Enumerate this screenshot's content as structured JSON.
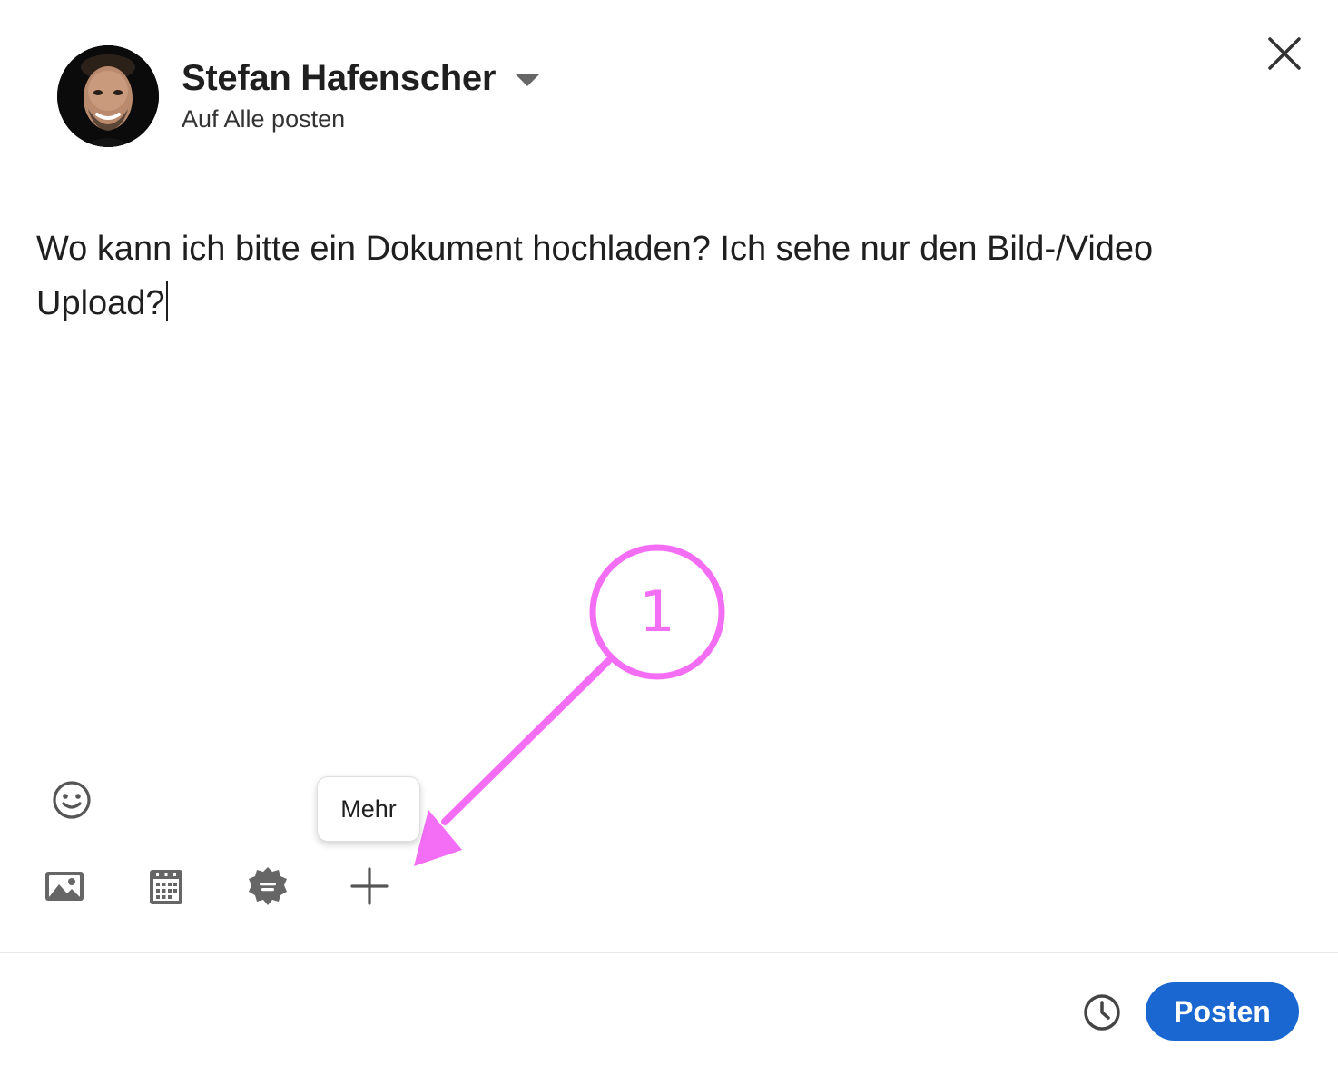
{
  "header": {
    "author_name": "Stefan Hafenscher",
    "audience": "Auf Alle posten"
  },
  "editor": {
    "line1": "Wo kann ich bitte ein Dokument hochladen? Ich sehe nur den Bild-/Video",
    "line2": "Upload?"
  },
  "annotation": {
    "number": "1",
    "color": "#f36ef5"
  },
  "tooltip": {
    "label": "Mehr"
  },
  "toolbar": {
    "icons": [
      "image-icon",
      "calendar-icon",
      "badge-icon",
      "plus-icon"
    ]
  },
  "footer": {
    "post_label": "Posten",
    "accent": "#1a67d2"
  }
}
